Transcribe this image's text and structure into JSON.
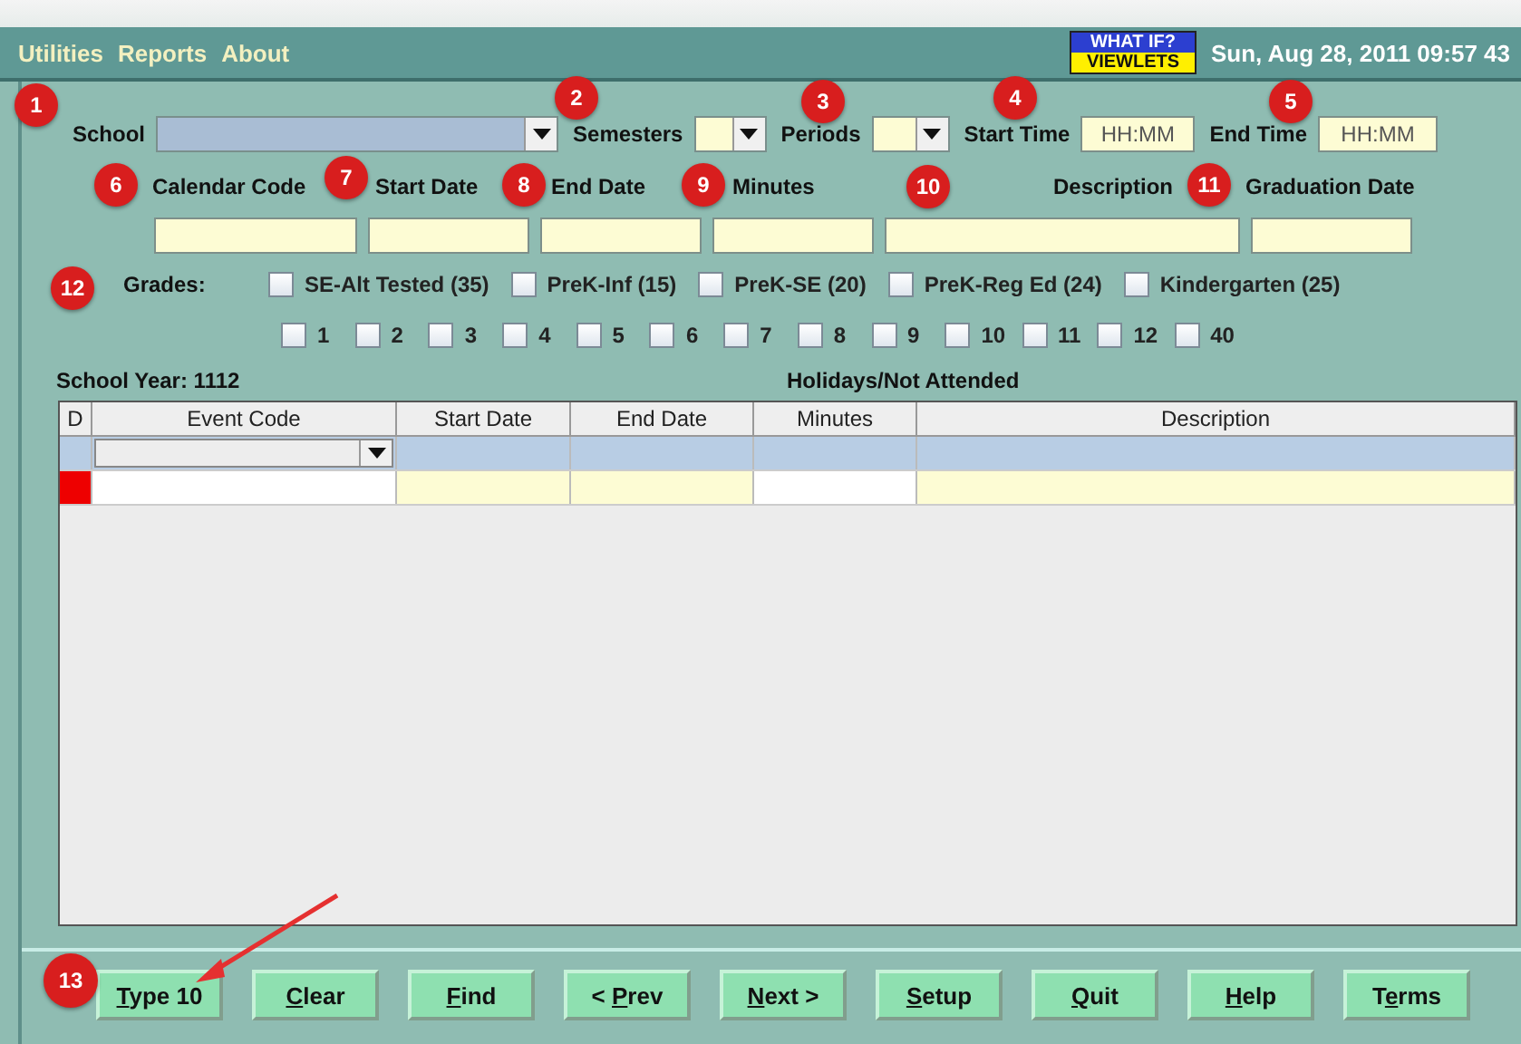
{
  "menu": [
    "Utilities",
    "Reports",
    "About"
  ],
  "logo": {
    "top": "WHAT IF?",
    "bottom": "VIEWLETS"
  },
  "datetime": "Sun, Aug 28, 2011 09:57 43",
  "filters": {
    "school": {
      "label": "School"
    },
    "semesters": {
      "label": "Semesters"
    },
    "periods": {
      "label": "Periods"
    },
    "start_time": {
      "label": "Start Time",
      "placeholder": "HH:MM"
    },
    "end_time": {
      "label": "End Time",
      "placeholder": "HH:MM"
    }
  },
  "detail_fields": [
    {
      "label": "Calendar Code"
    },
    {
      "label": "Start Date"
    },
    {
      "label": "End Date"
    },
    {
      "label": "Minutes"
    },
    {
      "label": "Description"
    },
    {
      "label": "Graduation Date"
    }
  ],
  "grades": {
    "label": "Grades:",
    "named": [
      {
        "label": "SE-Alt Tested (35)",
        "checked": false
      },
      {
        "label": "PreK-Inf (15)",
        "checked": false
      },
      {
        "label": "PreK-SE (20)",
        "checked": false
      },
      {
        "label": "PreK-Reg Ed (24)",
        "checked": false
      },
      {
        "label": "Kindergarten (25)",
        "checked": false
      }
    ],
    "numbered": [
      {
        "label": "1",
        "checked": false
      },
      {
        "label": "2",
        "checked": false
      },
      {
        "label": "3",
        "checked": false
      },
      {
        "label": "4",
        "checked": false
      },
      {
        "label": "5",
        "checked": false
      },
      {
        "label": "6",
        "checked": false
      },
      {
        "label": "7",
        "checked": false
      },
      {
        "label": "8",
        "checked": false
      },
      {
        "label": "9",
        "checked": false
      },
      {
        "label": "10",
        "checked": false
      },
      {
        "label": "11",
        "checked": false
      },
      {
        "label": "12",
        "checked": false
      },
      {
        "label": "40",
        "checked": false
      }
    ]
  },
  "school_year": "School Year: 1112",
  "table_title": "Holidays/Not Attended",
  "table": {
    "columns": [
      "D",
      "Event Code",
      "Start Date",
      "End Date",
      "Minutes",
      "Description"
    ],
    "rows": [
      {
        "selected": true,
        "flagged": false
      },
      {
        "selected": false,
        "flagged": true
      }
    ]
  },
  "buttons": [
    {
      "key": "T",
      "after": "ype 10"
    },
    {
      "key": "C",
      "after": "lear"
    },
    {
      "key": "F",
      "after": "ind"
    },
    {
      "before": "< ",
      "key": "P",
      "after": "rev"
    },
    {
      "key": "N",
      "after": "ext >"
    },
    {
      "key": "S",
      "after": "etup"
    },
    {
      "key": "Q",
      "after": "uit"
    },
    {
      "key": "H",
      "after": "elp"
    },
    {
      "before": "T",
      "key": "e",
      "after": "rms"
    }
  ],
  "markers": [
    "1",
    "2",
    "3",
    "4",
    "5",
    "6",
    "7",
    "8",
    "9",
    "10",
    "11",
    "12",
    "13"
  ]
}
